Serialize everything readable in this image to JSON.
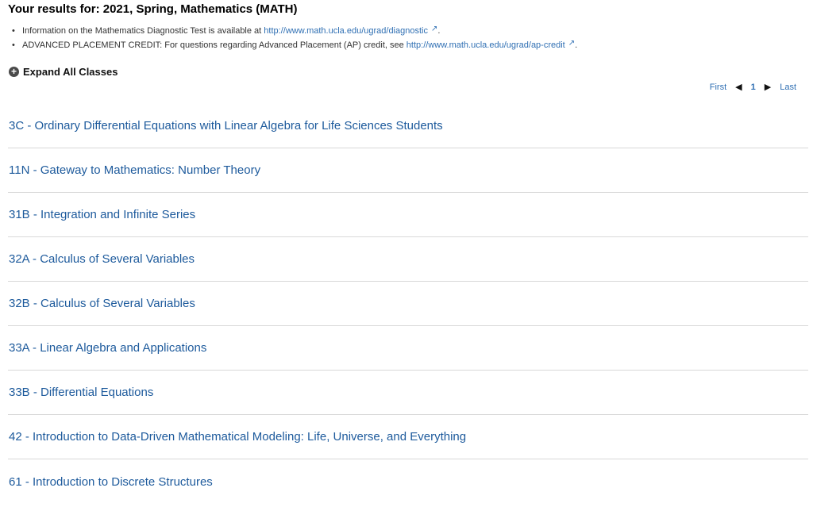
{
  "header": {
    "title": "Your results for: 2021, Spring, Mathematics (MATH)"
  },
  "info": {
    "items": [
      {
        "text": "Information on the Mathematics Diagnostic Test is available at ",
        "link": "http://www.math.ucla.edu/ugrad/diagnostic",
        "suffix": "."
      },
      {
        "text": "ADVANCED PLACEMENT CREDIT: For questions regarding Advanced Placement (AP) credit, see ",
        "link": "http://www.math.ucla.edu/ugrad/ap-credit",
        "suffix": "."
      }
    ],
    "external_icon": "external-link-icon"
  },
  "controls": {
    "expand_all_label": "Expand All Classes",
    "expand_icon": "plus-circle-icon"
  },
  "pager": {
    "first": "First",
    "prev_icon": "left-triangle-icon",
    "current": "1",
    "next_icon": "right-triangle-icon",
    "last": "Last"
  },
  "classes": [
    "3C - Ordinary Differential Equations with Linear Algebra for Life Sciences Students",
    "11N - Gateway to Mathematics: Number Theory",
    "31B - Integration and Infinite Series",
    "32A - Calculus of Several Variables",
    "32B - Calculus of Several Variables",
    "33A - Linear Algebra and Applications",
    "33B - Differential Equations",
    "42 - Introduction to Data-Driven Mathematical Modeling: Life, Universe, and Everything",
    "61 - Introduction to Discrete Structures"
  ],
  "colors": {
    "link": "#1d5a9c",
    "info_link": "#2f6fb3",
    "divider": "#d8d8d8"
  }
}
